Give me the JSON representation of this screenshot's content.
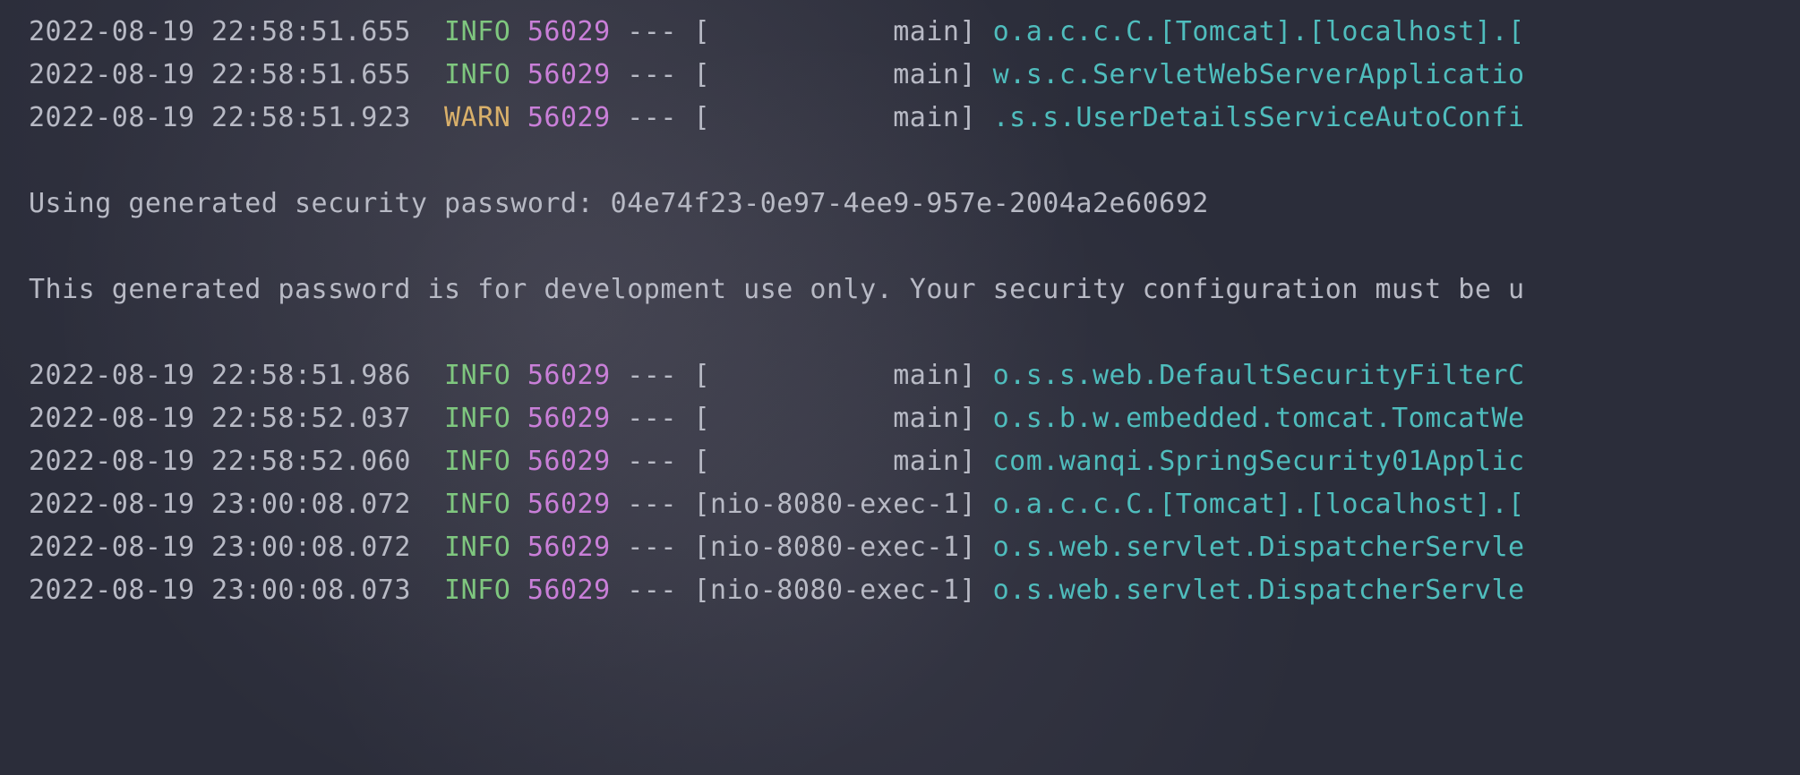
{
  "lines": [
    {
      "type": "log",
      "timestamp": "2022-08-19 22:58:51.655",
      "level": "INFO",
      "pid": "56029",
      "thread": "           main",
      "logger": "o.a.c.c.C.[Tomcat].[localhost].["
    },
    {
      "type": "log",
      "timestamp": "2022-08-19 22:58:51.655",
      "level": "INFO",
      "pid": "56029",
      "thread": "           main",
      "logger": "w.s.c.ServletWebServerApplicatio"
    },
    {
      "type": "log",
      "timestamp": "2022-08-19 22:58:51.923",
      "level": "WARN",
      "pid": "56029",
      "thread": "           main",
      "logger": ".s.s.UserDetailsServiceAutoConfi"
    },
    {
      "type": "blank"
    },
    {
      "type": "text",
      "text": "Using generated security password: 04e74f23-0e97-4ee9-957e-2004a2e60692"
    },
    {
      "type": "blank"
    },
    {
      "type": "text",
      "text": "This generated password is for development use only. Your security configuration must be u"
    },
    {
      "type": "blank"
    },
    {
      "type": "log",
      "timestamp": "2022-08-19 22:58:51.986",
      "level": "INFO",
      "pid": "56029",
      "thread": "           main",
      "logger": "o.s.s.web.DefaultSecurityFilterC"
    },
    {
      "type": "log",
      "timestamp": "2022-08-19 22:58:52.037",
      "level": "INFO",
      "pid": "56029",
      "thread": "           main",
      "logger": "o.s.b.w.embedded.tomcat.TomcatWe"
    },
    {
      "type": "log",
      "timestamp": "2022-08-19 22:58:52.060",
      "level": "INFO",
      "pid": "56029",
      "thread": "           main",
      "logger": "com.wanqi.SpringSecurity01Applic"
    },
    {
      "type": "log",
      "timestamp": "2022-08-19 23:00:08.072",
      "level": "INFO",
      "pid": "56029",
      "thread": "nio-8080-exec-1",
      "logger": "o.a.c.c.C.[Tomcat].[localhost].["
    },
    {
      "type": "log",
      "timestamp": "2022-08-19 23:00:08.072",
      "level": "INFO",
      "pid": "56029",
      "thread": "nio-8080-exec-1",
      "logger": "o.s.web.servlet.DispatcherServle"
    },
    {
      "type": "log",
      "timestamp": "2022-08-19 23:00:08.073",
      "level": "INFO",
      "pid": "56029",
      "thread": "nio-8080-exec-1",
      "logger": "o.s.web.servlet.DispatcherServle"
    }
  ],
  "colors": {
    "background": "#2b2d3a",
    "default": "#b8bac5",
    "info": "#7fc77f",
    "warn": "#d9b06a",
    "pid": "#c97fd8",
    "logger": "#4fbdbd"
  }
}
